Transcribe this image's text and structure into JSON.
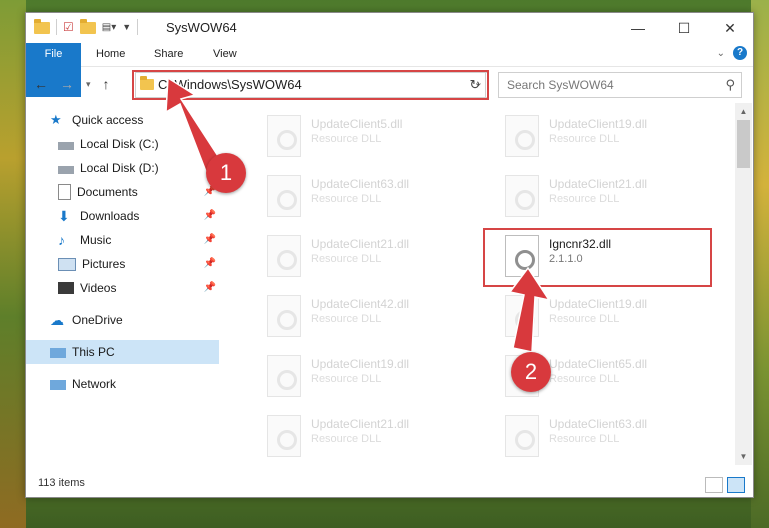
{
  "window": {
    "title": "SysWOW64"
  },
  "ribbon": {
    "tabs": [
      "File",
      "Home",
      "Share",
      "View"
    ],
    "help": "?"
  },
  "nav": {
    "address": "C:\\Windows\\SysWOW64",
    "search_placeholder": "Search SysWOW64"
  },
  "sidebar": {
    "quick_access": "Quick access",
    "items": [
      "Local Disk (C:)",
      "Local Disk (D:)",
      "Documents",
      "Downloads",
      "Music",
      "Pictures",
      "Videos"
    ],
    "onedrive": "OneDrive",
    "this_pc": "This PC",
    "network": "Network"
  },
  "files": {
    "left": [
      {
        "name": "UpdateClient5.dll",
        "type": "Resource DLL"
      },
      {
        "name": "UpdateClient63.dll",
        "type": "Resource DLL"
      },
      {
        "name": "UpdateClient21.dll",
        "type": "Resource DLL"
      },
      {
        "name": "UpdateClient42.dll",
        "type": "Resource DLL"
      },
      {
        "name": "UpdateClient19.dll",
        "type": "Resource DLL"
      },
      {
        "name": "UpdateClient21.dll",
        "type": "Resource DLL"
      }
    ],
    "right": [
      {
        "name": "UpdateClient19.dll",
        "type": "Resource DLL"
      },
      {
        "name": "UpdateClient21.dll",
        "type": "Resource DLL"
      },
      {
        "name": "Igncnr32.dll",
        "type": "2.1.1.0"
      },
      {
        "name": "UpdateClient19.dll",
        "type": "Resource DLL"
      },
      {
        "name": "UpdateClient65.dll",
        "type": "Resource DLL"
      },
      {
        "name": "UpdateClient63.dll",
        "type": "Resource DLL"
      }
    ]
  },
  "status": {
    "count": "113 items"
  },
  "annotations": {
    "step1": "1",
    "step2": "2",
    "color": "#d8393d"
  }
}
